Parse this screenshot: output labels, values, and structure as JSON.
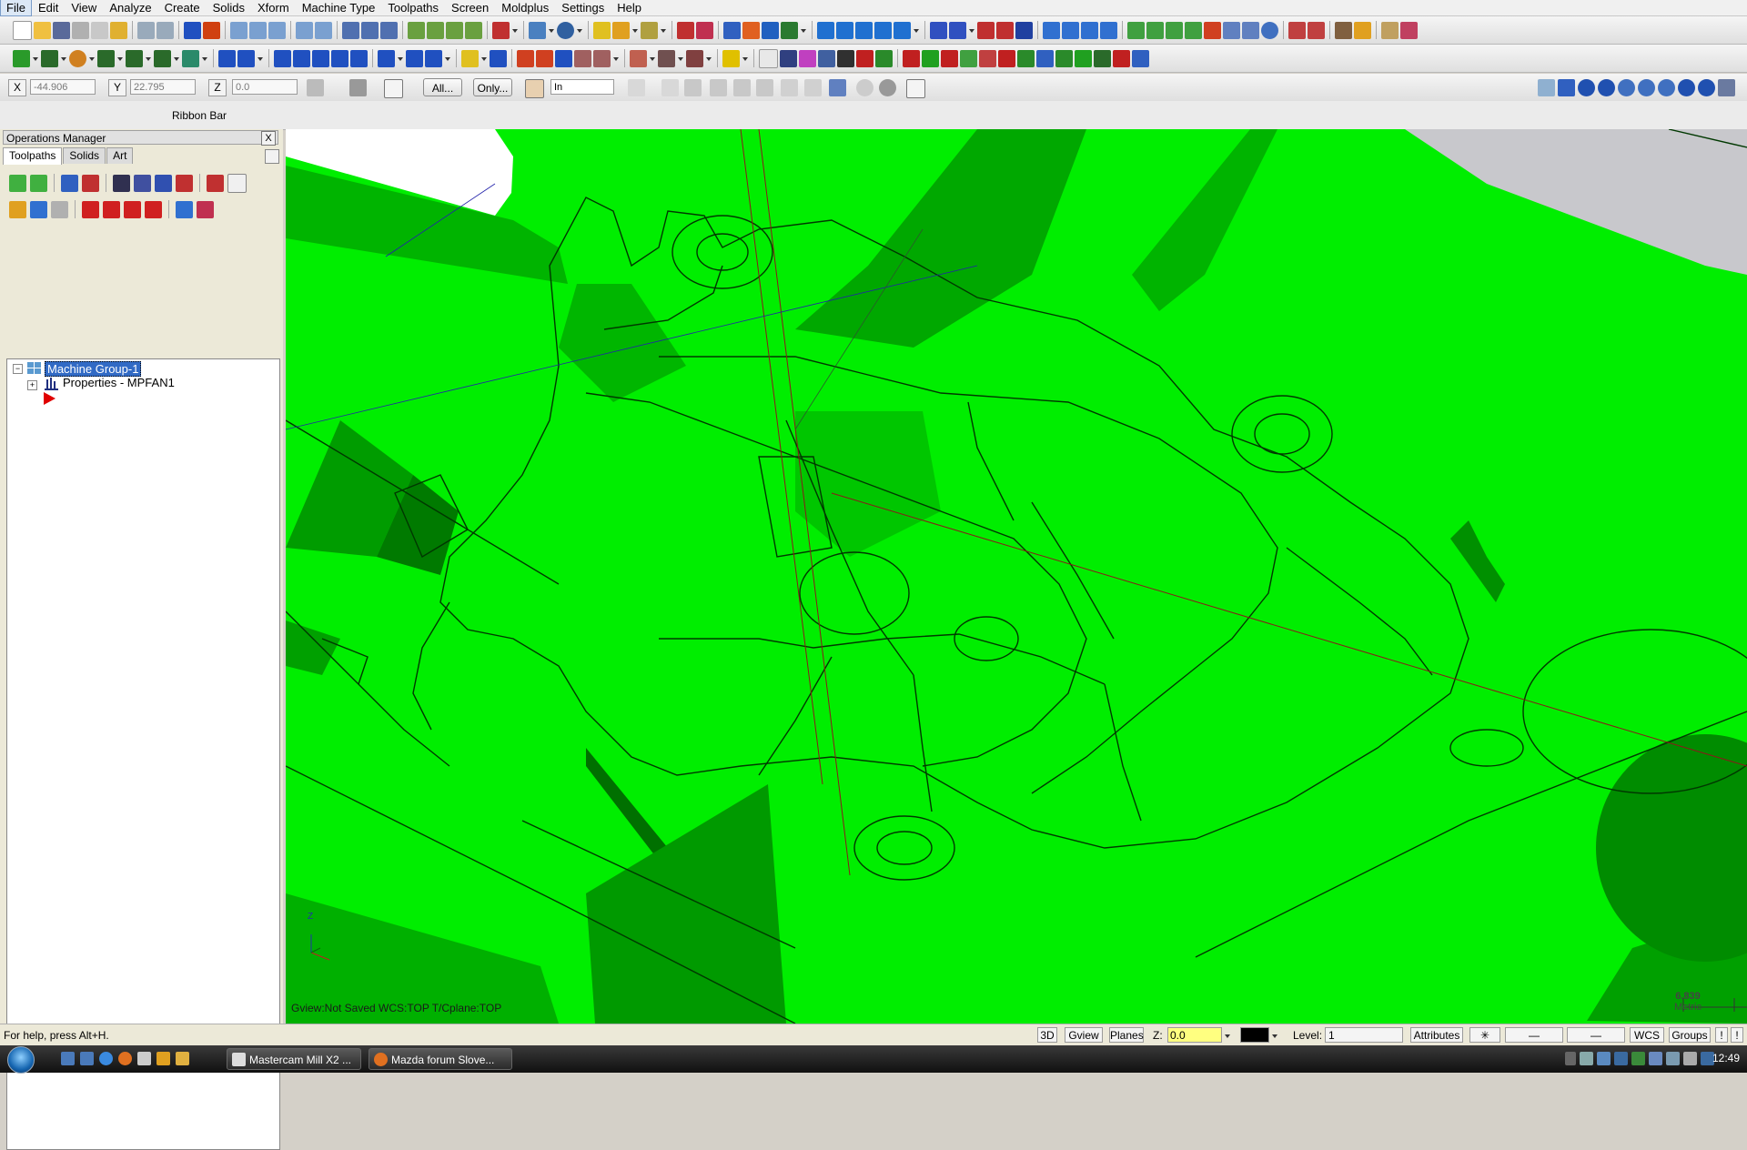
{
  "menu": [
    "File",
    "Edit",
    "View",
    "Analyze",
    "Create",
    "Solids",
    "Xform",
    "Machine Type",
    "Toolpaths",
    "Screen",
    "Moldplus",
    "Settings",
    "Help"
  ],
  "coords": {
    "x_label": "X",
    "x_value": "-44.906",
    "y_label": "Y",
    "y_value": "22.795",
    "z_label": "Z",
    "z_value": "0.0"
  },
  "selection": {
    "all_label": "All...",
    "only_label": "Only...",
    "mode_value": "In"
  },
  "ribbon_title": "Ribbon Bar",
  "ops_manager": {
    "title": "Operations Manager",
    "close": "X",
    "tabs": [
      "Toolpaths",
      "Solids",
      "Art"
    ],
    "tree": {
      "group": "Machine Group-1",
      "properties": "Properties - MPFAN1"
    }
  },
  "viewport": {
    "status": "Gview:Not Saved   WCS:TOP   T/Cplane:TOP",
    "scale_value": "6.839",
    "scale_unit": "Metric",
    "axis_label": "Z"
  },
  "statusbar": {
    "help": "For help, press Alt+H.",
    "b3d": "3D",
    "gview": "Gview",
    "planes": "Planes",
    "z_label": "Z:",
    "z_value": "0.0",
    "level_label": "Level:",
    "level_value": "1",
    "attributes": "Attributes",
    "wcs": "WCS",
    "groups": "Groups"
  },
  "taskbar": {
    "items": [
      "Mastercam Mill X2 ...",
      "Mazda forum Slove..."
    ],
    "clock": "12:49"
  },
  "colors": {
    "viewport_bg": "#00ee00",
    "selection_highlight": "#316ac5"
  }
}
